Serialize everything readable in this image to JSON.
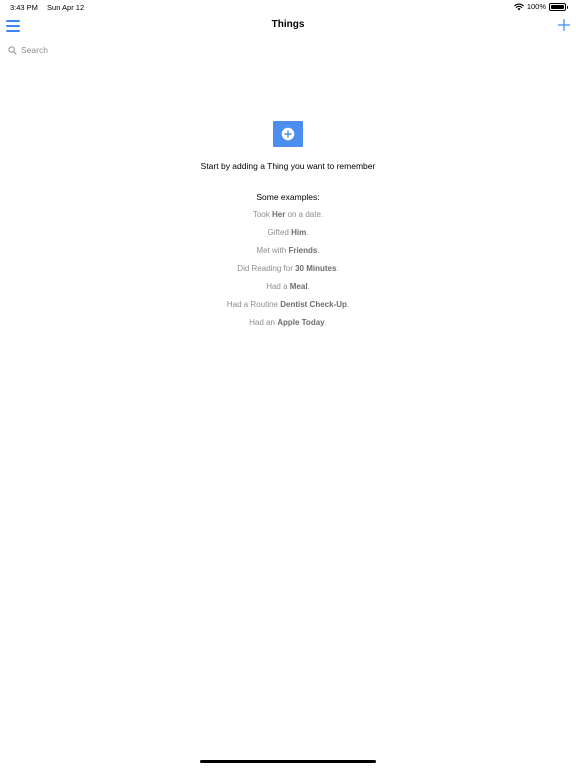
{
  "status": {
    "time": "3:43 PM",
    "date": "Sun Apr 12",
    "battery": "100%",
    "battery_level": 1.0,
    "icons": [
      "wifi-icon",
      "battery-icon"
    ]
  },
  "nav": {
    "title": "Things",
    "left_icon": "hamburger-menu-icon",
    "right_icon": "plus-icon"
  },
  "search": {
    "placeholder": "Search",
    "value": "",
    "icon": "search-icon"
  },
  "empty_state": {
    "icon": "add-circle-icon",
    "prompt": "Start by adding a Thing you want to remember"
  },
  "examples": {
    "heading": "Some examples:",
    "items": [
      {
        "pre": "Took ",
        "bold": "Her",
        "post": " on a date."
      },
      {
        "pre": "Gifted ",
        "bold": "Him",
        "post": "."
      },
      {
        "pre": "Met with ",
        "bold": "Friends",
        "post": "."
      },
      {
        "pre": "Did Reading for ",
        "bold": "30 Minutes",
        "post": "."
      },
      {
        "pre": "Had a ",
        "bold": "Meal",
        "post": "."
      },
      {
        "pre": "Had a Routine ",
        "bold": "Dentist Check-Up",
        "post": "."
      },
      {
        "pre": "Had an ",
        "bold": "Apple Today",
        "post": "."
      }
    ]
  },
  "colors": {
    "accent": "#3d87f5",
    "button_bg": "#4a8ef0",
    "secondary_text": "#8e8e93"
  }
}
